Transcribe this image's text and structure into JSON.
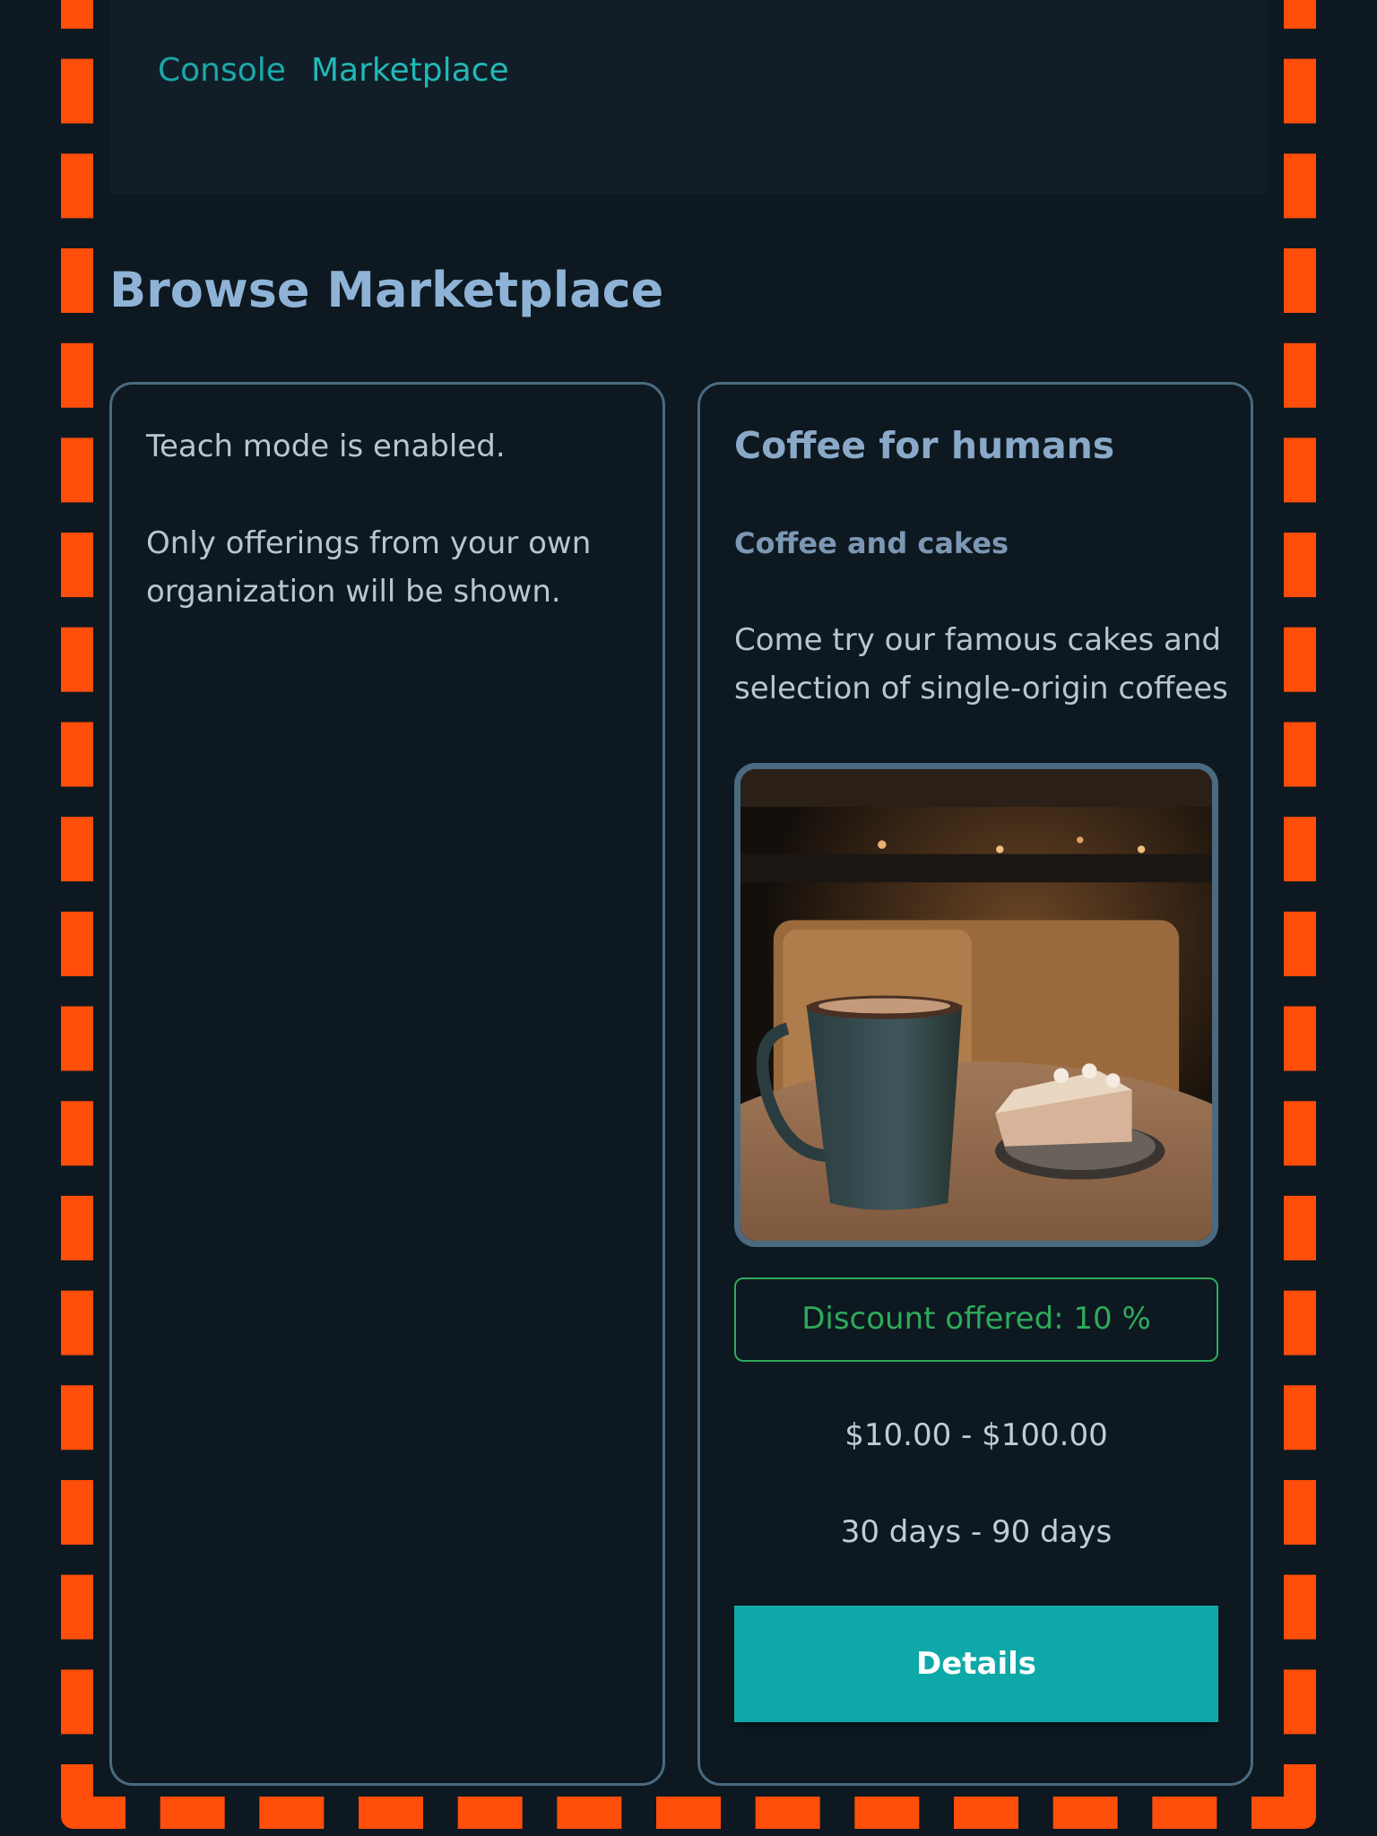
{
  "nav": {
    "console_label": "Console",
    "marketplace_label": "Marketplace"
  },
  "page": {
    "title": "Browse Marketplace"
  },
  "info_card": {
    "line1": "Teach mode is enabled.",
    "line2": "Only offerings from your own organization will be shown."
  },
  "offering": {
    "title": "Coffee for humans",
    "subtitle": "Coffee and cakes",
    "description": "Come try our famous cakes and selection of single-origin coffees",
    "image_icon": "coffee-and-cake-photo",
    "discount": "Discount offered: 10 %",
    "price_range": "$10.00 - $100.00",
    "duration_range": "30 days - 90 days",
    "details_label": "Details"
  },
  "colors": {
    "background": "#0d1820",
    "accent": "#0ea8a8",
    "frame_dash": "#ff4d0a",
    "discount": "#2eaa5a",
    "card_border": "#4b6a80"
  }
}
